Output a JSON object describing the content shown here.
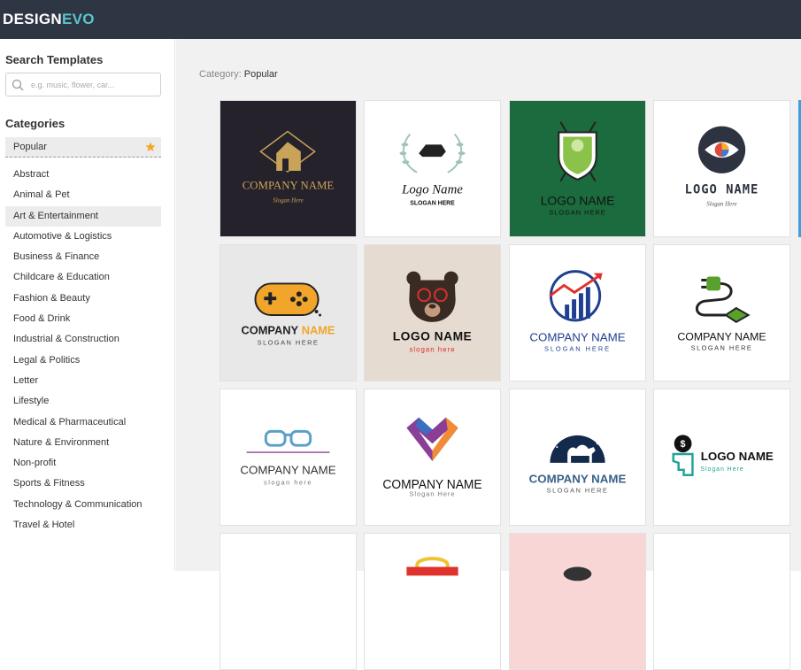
{
  "brand": {
    "part1": "DESIGN",
    "part2": "EVO"
  },
  "sidebar": {
    "search_heading": "Search Templates",
    "search_placeholder": "e.g. music, flower, car...",
    "categories_heading": "Categories",
    "popular_label": "Popular",
    "categories": [
      "Abstract",
      "Animal & Pet",
      "Art & Entertainment",
      "Automotive & Logistics",
      "Business & Finance",
      "Childcare & Education",
      "Fashion & Beauty",
      "Food & Drink",
      "Industrial & Construction",
      "Legal & Politics",
      "Letter",
      "Lifestyle",
      "Medical & Pharmaceutical",
      "Nature & Environment",
      "Non-profit",
      "Sports & Fitness",
      "Technology & Communication",
      "Travel & Hotel"
    ],
    "active_category_index": 2
  },
  "main": {
    "category_prefix": "Category:",
    "category_value": "Popular",
    "cards": [
      {
        "name": "COMPANY NAME",
        "slogan": "Slogan Here",
        "bg": "#26222c",
        "accent": "#c9a35a"
      },
      {
        "name": "Logo Name",
        "slogan": "SLOGAN HERE",
        "bg": "#ffffff",
        "accent": "#9fc4bc"
      },
      {
        "name": "LOGO NAME",
        "slogan": "SLOGAN HERE",
        "bg": "#1b6b3e",
        "accent": "#8bc34a"
      },
      {
        "name": "LOGO NAME",
        "slogan": "Slogan Here",
        "bg": "#ffffff",
        "accent": "#2d3340"
      },
      {
        "name1": "COMPANY",
        "name2": "NAME",
        "slogan": "SLOGAN HERE",
        "bg": "#e8e8e8",
        "accent": "#f1a52a"
      },
      {
        "name": "LOGO NAME",
        "slogan": "slogan here",
        "bg": "#e6dbd1",
        "accent": "#d9302f"
      },
      {
        "name": "COMPANY NAME",
        "slogan": "SLOGAN HERE",
        "bg": "#ffffff",
        "accent": "#1f3f8f"
      },
      {
        "name": "COMPANY NAME",
        "slogan": "SLOGAN HERE",
        "bg": "#ffffff",
        "accent": "#5aa02c"
      },
      {
        "name": "COMPANY NAME",
        "slogan": "slogan here",
        "bg": "#ffffff",
        "accent": "#5aa0c8"
      },
      {
        "name": "COMPANY NAME",
        "slogan": "Slogan Here",
        "bg": "#ffffff",
        "accent": "#8a3e96"
      },
      {
        "name": "COMPANY NAME",
        "slogan": "SLOGAN HERE",
        "bg": "#ffffff",
        "accent": "#3a6189"
      },
      {
        "name": "LOGO NAME",
        "slogan": "Slogan Here",
        "bg": "#ffffff",
        "accent": "#21a397"
      }
    ]
  },
  "colors": {
    "topbar": "#2e3543",
    "brand_accent": "#59c6cc",
    "star": "#f5a623"
  }
}
